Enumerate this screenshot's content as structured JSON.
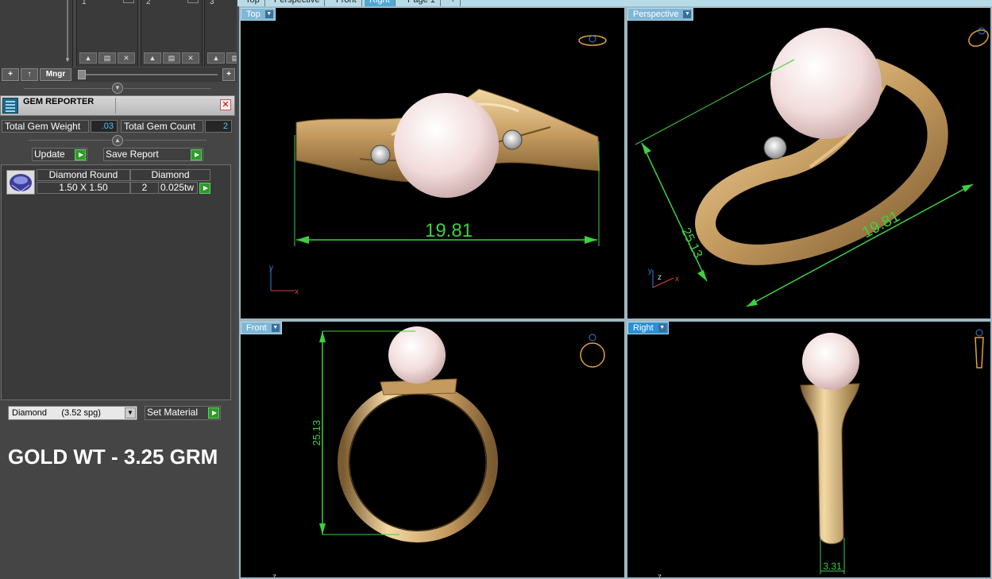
{
  "panel_top": {
    "slots": [
      "1",
      "2",
      "3"
    ],
    "toolbar": {
      "add_label": "+",
      "up_label": "↑",
      "mngr_label": "Mngr",
      "plus_label": "+"
    }
  },
  "gem_reporter": {
    "title": "GEM REPORTER",
    "total_weight_label": "Total Gem Weight",
    "total_weight_value": ".03",
    "total_count_label": "Total Gem Count",
    "total_count_value": "2",
    "update_label": "Update",
    "save_report_label": "Save Report",
    "rows": [
      {
        "shape": "Diamond Round",
        "size": "1.50 X 1.50",
        "material": "Diamond",
        "qty": "2",
        "weight": "0.025tw"
      }
    ]
  },
  "material": {
    "selected": "Diamond      (3.52 spg)",
    "set_label": "Set Material"
  },
  "annotation": {
    "gold_weight": "GOLD WT - 3.25 GRM"
  },
  "view_tabs": [
    "Top",
    "Perspective",
    "Front",
    "Right",
    "Page 1",
    "+"
  ],
  "active_tab": "Right",
  "viewports": {
    "top": {
      "label": "Top",
      "dimension": "19.81"
    },
    "perspective": {
      "label": "Perspective",
      "dimension_a": "25.13",
      "dimension_b": "19.81"
    },
    "front": {
      "label": "Front",
      "dimension": "25.13"
    },
    "right": {
      "label": "Right",
      "dimension": "3.31"
    }
  },
  "colors": {
    "gold": "#c9a46a",
    "pearl": "#f2dcdc",
    "dimension_green": "#3fcf3f",
    "viewport_bg": "#000000",
    "accent": "#2b8fd6"
  }
}
